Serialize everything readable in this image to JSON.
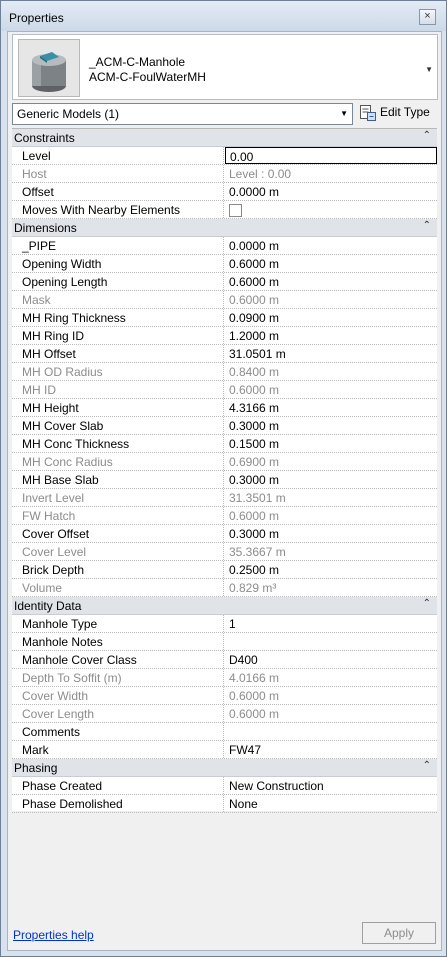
{
  "window": {
    "title": "Properties",
    "close_glyph": "×"
  },
  "type_selector": {
    "family": "_ACM-C-Manhole",
    "type": "ACM-C-FoulWaterMH",
    "dropdown_icon": "triangle-down-icon"
  },
  "filter": {
    "value": "Generic Models (1)",
    "edit_type_label": "Edit Type"
  },
  "groups": [
    {
      "label": "Constraints",
      "rows": [
        {
          "name": "Level",
          "value": "0.00",
          "readonly": false,
          "editing": true
        },
        {
          "name": "Host",
          "value": "Level : 0.00",
          "readonly": true
        },
        {
          "name": "Offset",
          "value": "0.0000 m",
          "readonly": false
        },
        {
          "name": "Moves With Nearby Elements",
          "value": "",
          "readonly": false,
          "checkbox": true
        }
      ]
    },
    {
      "label": "Dimensions",
      "rows": [
        {
          "name": "_PIPE",
          "value": "0.0000 m",
          "readonly": false
        },
        {
          "name": "Opening Width",
          "value": "0.6000 m",
          "readonly": false
        },
        {
          "name": "Opening Length",
          "value": "0.6000 m",
          "readonly": false
        },
        {
          "name": "Mask",
          "value": "0.6000 m",
          "readonly": true
        },
        {
          "name": "MH Ring Thickness",
          "value": "0.0900 m",
          "readonly": false
        },
        {
          "name": "MH Ring ID",
          "value": "1.2000 m",
          "readonly": false
        },
        {
          "name": "MH Offset",
          "value": "31.0501 m",
          "readonly": false
        },
        {
          "name": "MH OD Radius",
          "value": "0.8400 m",
          "readonly": true
        },
        {
          "name": "MH ID",
          "value": "0.6000 m",
          "readonly": true
        },
        {
          "name": "MH Height",
          "value": "4.3166 m",
          "readonly": false
        },
        {
          "name": "MH Cover Slab",
          "value": "0.3000 m",
          "readonly": false
        },
        {
          "name": "MH Conc Thickness",
          "value": "0.1500 m",
          "readonly": false
        },
        {
          "name": "MH Conc Radius",
          "value": "0.6900 m",
          "readonly": true
        },
        {
          "name": "MH Base Slab",
          "value": "0.3000 m",
          "readonly": false
        },
        {
          "name": "Invert Level",
          "value": "31.3501 m",
          "readonly": true
        },
        {
          "name": "FW Hatch",
          "value": "0.6000 m",
          "readonly": true
        },
        {
          "name": "Cover Offset",
          "value": "0.3000 m",
          "readonly": false
        },
        {
          "name": "Cover Level",
          "value": "35.3667 m",
          "readonly": true
        },
        {
          "name": "Brick Depth",
          "value": "0.2500 m",
          "readonly": false
        },
        {
          "name": "Volume",
          "value": "0.829 m³",
          "readonly": true
        }
      ]
    },
    {
      "label": "Identity Data",
      "rows": [
        {
          "name": "Manhole Type",
          "value": "1",
          "readonly": false
        },
        {
          "name": "Manhole Notes",
          "value": "",
          "readonly": false
        },
        {
          "name": "Manhole Cover Class",
          "value": "D400",
          "readonly": false
        },
        {
          "name": "Depth To Soffit (m)",
          "value": "4.0166 m",
          "readonly": true
        },
        {
          "name": "Cover Width",
          "value": "0.6000 m",
          "readonly": true
        },
        {
          "name": "Cover Length",
          "value": "0.6000 m",
          "readonly": true
        },
        {
          "name": "Comments",
          "value": "",
          "readonly": false
        },
        {
          "name": "Mark",
          "value": "FW47",
          "readonly": false
        }
      ]
    },
    {
      "label": "Phasing",
      "rows": [
        {
          "name": "Phase Created",
          "value": "New Construction",
          "readonly": false
        },
        {
          "name": "Phase Demolished",
          "value": "None",
          "readonly": false
        }
      ]
    }
  ],
  "footer": {
    "help_link": "Properties help",
    "apply_label": "Apply"
  },
  "colors": {
    "readonly_text": "#8c8c8c",
    "group_header_bg": "#e0e3e8",
    "link": "#0033cc"
  }
}
